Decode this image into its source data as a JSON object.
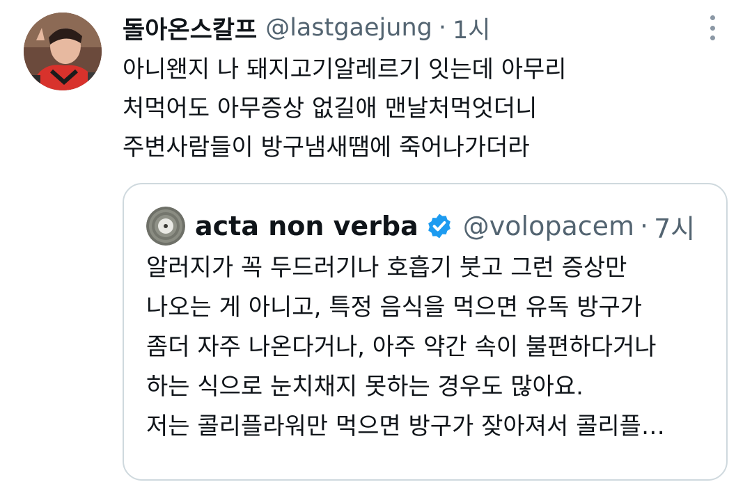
{
  "tweet": {
    "display_name": "돌아온스칼프",
    "handle": "@lastgaejung",
    "separator": "·",
    "time": "1시",
    "text_lines": [
      "아니왠지 나 돼지고기알레르기 잇는데 아무리",
      "처먹어도 아무증상 없길애 맨날처먹엇더니",
      "주변사람들이 방구냄새땜에 죽어나가더라"
    ],
    "more_icon": "more-vertical-icon"
  },
  "quoted_tweet": {
    "display_name": "acta non verba",
    "verified_icon": "verified-badge-icon",
    "verified_color": "#1d9bf0",
    "handle": "@volopacem",
    "separator": "·",
    "time": "7시",
    "text_lines": [
      "알러지가 꼭 두드러기나 호흡기 붓고 그런 증상만",
      "나오는 게 아니고, 특정 음식을 먹으면 유독 방구가",
      "좀더 자주 나온다거나, 아주 약간 속이 불편하다거나",
      "하는 식으로 눈치채지 못하는 경우도 많아요.",
      "저는 콜리플라워만 먹으면 방구가 잦아져서 콜리플…"
    ]
  },
  "colors": {
    "text_primary": "#0f1419",
    "text_secondary": "#536471",
    "border": "#cfd9de",
    "accent": "#1d9bf0"
  }
}
